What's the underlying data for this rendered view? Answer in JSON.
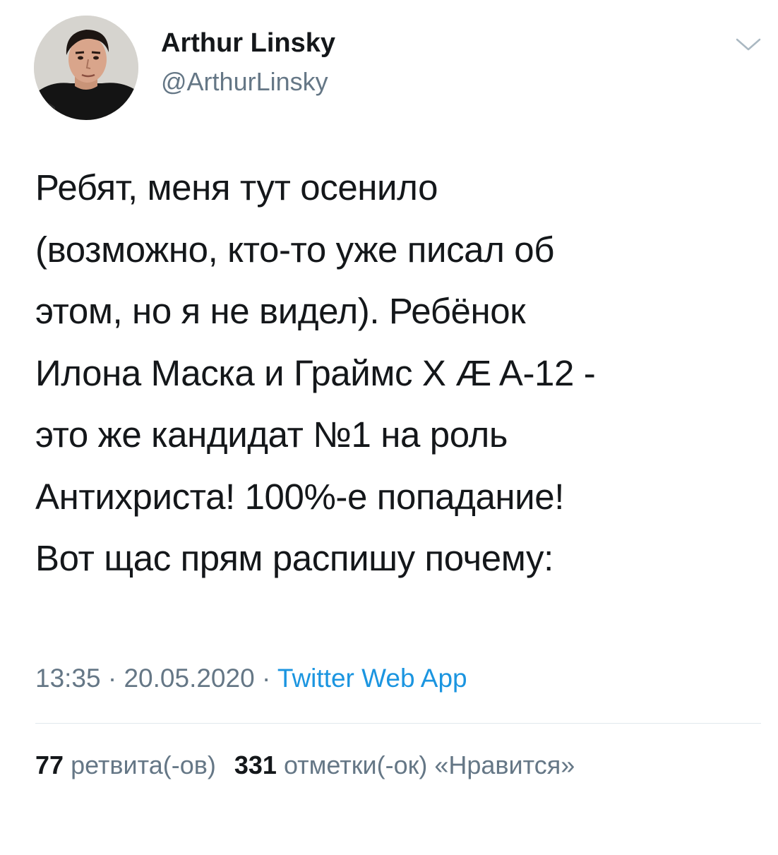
{
  "tweet": {
    "author": {
      "display_name": "Arthur Linsky",
      "handle": "@ArthurLinsky"
    },
    "text_lines": [
      "Ребят, меня тут осенило",
      "(возможно, кто-то уже писал об",
      "этом, но я не видел). Ребёнок",
      "Илона Маска и Граймс X Æ A-12 -",
      "это же кандидат №1 на роль",
      "Антихриста! 100%-е попадание!",
      "Вот щас прям распишу почему:"
    ],
    "time": "13:35",
    "date": "20.05.2020",
    "separator": "·",
    "source": "Twitter Web App",
    "retweets": {
      "count": "77",
      "label": "ретвита(-ов)"
    },
    "likes": {
      "count": "331",
      "label": "отметки(-ок) «Нравится»"
    }
  },
  "icons": {
    "menu": "chevron-down-icon",
    "avatar": "profile-photo"
  },
  "colors": {
    "text": "#14171a",
    "secondary": "#657786",
    "link": "#1b95e0",
    "divider": "#e1e8ed",
    "background": "#ffffff"
  }
}
